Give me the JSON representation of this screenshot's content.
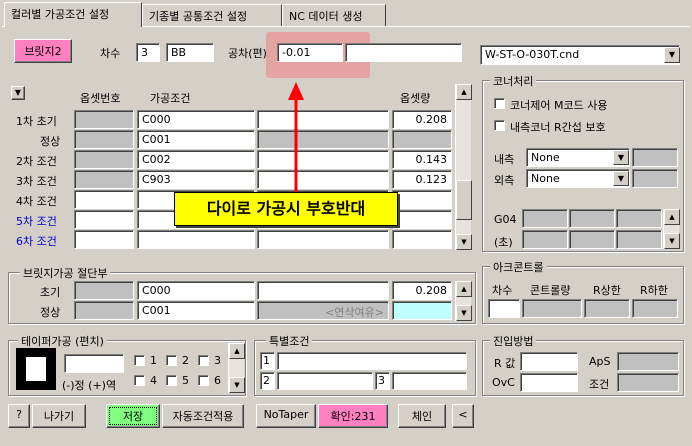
{
  "tabs": [
    {
      "label": "컬러별 가공조건 설정"
    },
    {
      "label": "기종별 공통조건 설정"
    },
    {
      "label": "NC 데이터 생성"
    }
  ],
  "top": {
    "bridge_btn": "브릿지2",
    "chasu_label": "차수",
    "chasu_value": "3",
    "bb_value": "BB",
    "tolerance_label": "공차(편)",
    "tolerance_value": "-0.01",
    "machine_select": "W-ST-O-030T.cnd"
  },
  "process_table": {
    "headers": {
      "offset_no": "옵셋번호",
      "condition": "가공조건",
      "offset_amt": "옵셋량"
    },
    "rows": [
      {
        "label": "1차 초기",
        "condition": "C000",
        "offset": "0.208",
        "blue": false
      },
      {
        "label": "정상",
        "condition": "C001",
        "offset": "",
        "blue": false
      },
      {
        "label": "2차 조건",
        "condition": "C002",
        "offset": "0.143",
        "blue": false
      },
      {
        "label": "3차 조건",
        "condition": "C903",
        "offset": "0.123",
        "blue": false
      },
      {
        "label": "4차 조건",
        "condition": "",
        "offset": "",
        "blue": false
      },
      {
        "label": "5차 조건",
        "condition": "",
        "offset": "",
        "blue": true
      },
      {
        "label": "6차 조건",
        "condition": "",
        "offset": "",
        "blue": true
      }
    ]
  },
  "annotation": {
    "text": "다이로 가공시 부호반대",
    "color": "#ff0000"
  },
  "corner": {
    "title": "코너처리",
    "cb1": "코너제어 M코드 사용",
    "cb2": "내측코너 R간섭 보호",
    "inner_label": "내측",
    "inner_value": "None",
    "outer_label": "외측",
    "outer_value": "None",
    "g04_label": "G04",
    "sec_label": "(초)"
  },
  "bridge_cut": {
    "title": "브릿지가공 절단부",
    "row1_label": "초기",
    "row1_cond": "C000",
    "row1_offset": "0.208",
    "row2_label": "정상",
    "row2_cond": "C001",
    "row2_margin": "<연삭여유>"
  },
  "arc_control": {
    "title": "아크콘트롤",
    "col1": "차수",
    "col2": "콘트롤량",
    "col3": "R상한",
    "col4": "R하한"
  },
  "taper": {
    "title": "테이퍼가공 (편치)",
    "sign_label": "(-)정 (+)역",
    "cbs": [
      "1",
      "2",
      "3",
      "4",
      "5",
      "6"
    ]
  },
  "special": {
    "title": "특별조건",
    "n1": "1",
    "n2": "2",
    "n3": "3"
  },
  "approach": {
    "title": "진입방법",
    "r_label": "R 값",
    "aps_label": "ApS",
    "ovc_label": "OvC",
    "cond_label": "조건"
  },
  "bottom": {
    "help": "?",
    "exit": "나가기",
    "save": "저장",
    "auto_apply": "자동조건적용",
    "notaper": "NoTaper",
    "confirm": "확인:231",
    "chain": "체인",
    "back": "<"
  },
  "colors": {
    "pink": "#ff80c0",
    "green_save": "#80ff80",
    "cyan_box": "#c0ffff",
    "highlight": "#e89c9c",
    "annotation_bg": "#ffff00"
  }
}
